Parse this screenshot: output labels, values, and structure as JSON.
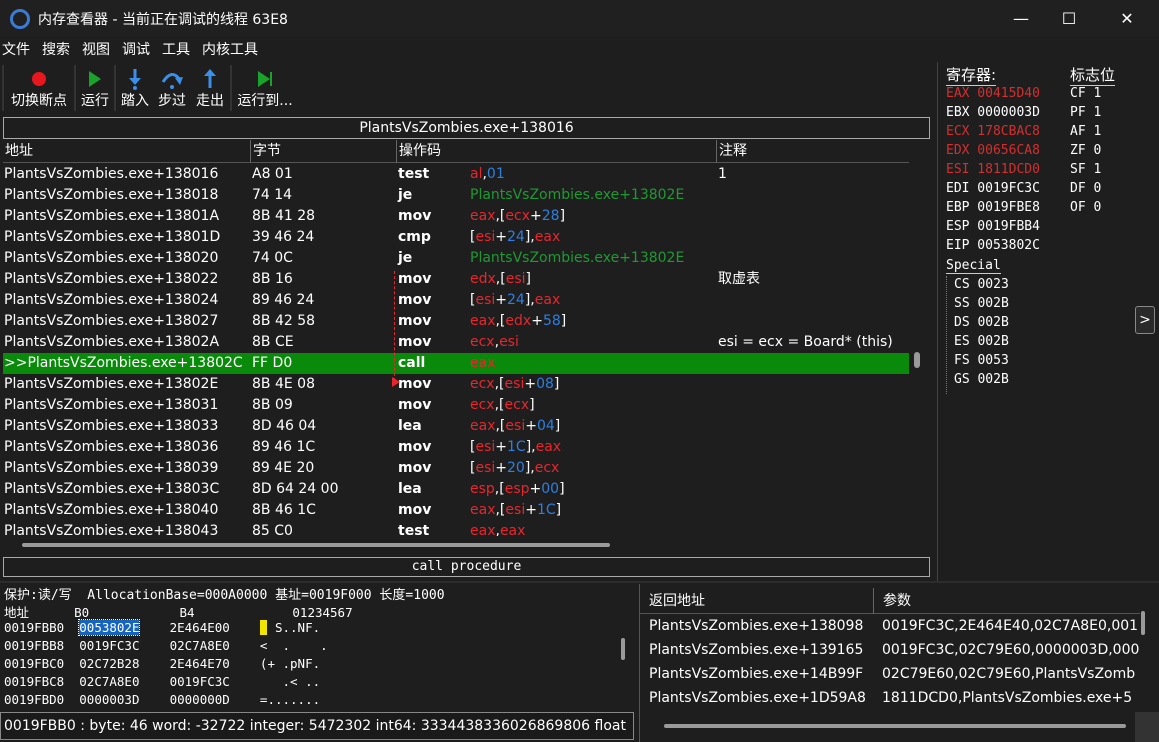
{
  "window": {
    "title": "内存查看器 - 当前正在调试的线程 63E8",
    "minimize": "—",
    "maximize": "☐",
    "close": "✕"
  },
  "menu": [
    "文件",
    "搜索",
    "视图",
    "调试",
    "工具",
    "内核工具"
  ],
  "toolbar": [
    {
      "label": "切换断点",
      "icon": "breakpoint-icon"
    },
    {
      "label": "运行",
      "icon": "play-icon"
    },
    {
      "label": "踏入",
      "icon": "step-into-icon"
    },
    {
      "label": "步过",
      "icon": "step-over-icon"
    },
    {
      "label": "走出",
      "icon": "step-out-icon"
    },
    {
      "label": "运行到...",
      "icon": "run-to-icon"
    }
  ],
  "disasm": {
    "header": "PlantsVsZombies.exe+138016",
    "columns": [
      "地址",
      "字节",
      "操作码",
      "注释"
    ],
    "rows": [
      {
        "addr": "PlantsVsZombies.exe+138016",
        "bytes": "A8 01",
        "op": "test",
        "args": [
          [
            "r",
            "al"
          ],
          [
            "w",
            ","
          ],
          [
            "b",
            "01"
          ]
        ],
        "cmt": "1"
      },
      {
        "addr": "PlantsVsZombies.exe+138018",
        "bytes": "74 14",
        "op": "je",
        "args": [
          [
            "g",
            "PlantsVsZombies.exe+13802E"
          ]
        ],
        "cmt": ""
      },
      {
        "addr": "PlantsVsZombies.exe+13801A",
        "bytes": "8B 41 28",
        "op": "mov",
        "args": [
          [
            "r",
            "eax"
          ],
          [
            "w",
            ",["
          ],
          [
            "r",
            "ecx"
          ],
          [
            "w",
            "+"
          ],
          [
            "b",
            "28"
          ],
          [
            "w",
            "]"
          ]
        ],
        "cmt": ""
      },
      {
        "addr": "PlantsVsZombies.exe+13801D",
        "bytes": "39 46 24",
        "op": "cmp",
        "args": [
          [
            "w",
            "["
          ],
          [
            "r",
            "esi"
          ],
          [
            "w",
            "+"
          ],
          [
            "b",
            "24"
          ],
          [
            "w",
            "],"
          ],
          [
            "r",
            "eax"
          ]
        ],
        "cmt": ""
      },
      {
        "addr": "PlantsVsZombies.exe+138020",
        "bytes": "74 0C",
        "op": "je",
        "args": [
          [
            "g",
            "PlantsVsZombies.exe+13802E"
          ]
        ],
        "cmt": ""
      },
      {
        "addr": "PlantsVsZombies.exe+138022",
        "bytes": "8B 16",
        "op": "mov",
        "args": [
          [
            "r",
            "edx"
          ],
          [
            "w",
            ",["
          ],
          [
            "r",
            "esi"
          ],
          [
            "w",
            "]"
          ]
        ],
        "cmt": "取虚表"
      },
      {
        "addr": "PlantsVsZombies.exe+138024",
        "bytes": "89 46 24",
        "op": "mov",
        "args": [
          [
            "w",
            "["
          ],
          [
            "r",
            "esi"
          ],
          [
            "w",
            "+"
          ],
          [
            "b",
            "24"
          ],
          [
            "w",
            "],"
          ],
          [
            "r",
            "eax"
          ]
        ],
        "cmt": ""
      },
      {
        "addr": "PlantsVsZombies.exe+138027",
        "bytes": "8B 42 58",
        "op": "mov",
        "args": [
          [
            "r",
            "eax"
          ],
          [
            "w",
            ",["
          ],
          [
            "r",
            "edx"
          ],
          [
            "w",
            "+"
          ],
          [
            "b",
            "58"
          ],
          [
            "w",
            "]"
          ]
        ],
        "cmt": ""
      },
      {
        "addr": "PlantsVsZombies.exe+13802A",
        "bytes": "8B CE",
        "op": "mov",
        "args": [
          [
            "r",
            "ecx"
          ],
          [
            "w",
            ","
          ],
          [
            "r",
            "esi"
          ]
        ],
        "cmt": "esi = ecx = Board* (this)"
      },
      {
        "addr": ">>PlantsVsZombies.exe+13802C",
        "bytes": "FF D0",
        "op": "call",
        "args": [
          [
            "r",
            "eax"
          ]
        ],
        "cmt": "",
        "selected": true
      },
      {
        "addr": "PlantsVsZombies.exe+13802E",
        "bytes": "8B 4E 08",
        "op": "mov",
        "args": [
          [
            "r",
            "ecx"
          ],
          [
            "w",
            ",["
          ],
          [
            "r",
            "esi"
          ],
          [
            "w",
            "+"
          ],
          [
            "b",
            "08"
          ],
          [
            "w",
            "]"
          ]
        ],
        "cmt": ""
      },
      {
        "addr": "PlantsVsZombies.exe+138031",
        "bytes": "8B 09",
        "op": "mov",
        "args": [
          [
            "r",
            "ecx"
          ],
          [
            "w",
            ",["
          ],
          [
            "r",
            "ecx"
          ],
          [
            "w",
            "]"
          ]
        ],
        "cmt": ""
      },
      {
        "addr": "PlantsVsZombies.exe+138033",
        "bytes": "8D 46 04",
        "op": "lea",
        "args": [
          [
            "r",
            "eax"
          ],
          [
            "w",
            ",["
          ],
          [
            "r",
            "esi"
          ],
          [
            "w",
            "+"
          ],
          [
            "b",
            "04"
          ],
          [
            "w",
            "]"
          ]
        ],
        "cmt": ""
      },
      {
        "addr": "PlantsVsZombies.exe+138036",
        "bytes": "89 46 1C",
        "op": "mov",
        "args": [
          [
            "w",
            "["
          ],
          [
            "r",
            "esi"
          ],
          [
            "w",
            "+"
          ],
          [
            "b",
            "1C"
          ],
          [
            "w",
            "],"
          ],
          [
            "r",
            "eax"
          ]
        ],
        "cmt": ""
      },
      {
        "addr": "PlantsVsZombies.exe+138039",
        "bytes": "89 4E 20",
        "op": "mov",
        "args": [
          [
            "w",
            "["
          ],
          [
            "r",
            "esi"
          ],
          [
            "w",
            "+"
          ],
          [
            "b",
            "20"
          ],
          [
            "w",
            "],"
          ],
          [
            "r",
            "ecx"
          ]
        ],
        "cmt": ""
      },
      {
        "addr": "PlantsVsZombies.exe+13803C",
        "bytes": "8D 64 24 00",
        "op": "lea",
        "args": [
          [
            "r",
            "esp"
          ],
          [
            "w",
            ",["
          ],
          [
            "r",
            "esp"
          ],
          [
            "w",
            "+"
          ],
          [
            "b",
            "00"
          ],
          [
            "w",
            "]"
          ]
        ],
        "cmt": ""
      },
      {
        "addr": "PlantsVsZombies.exe+138040",
        "bytes": "8B 46 1C",
        "op": "mov",
        "args": [
          [
            "r",
            "eax"
          ],
          [
            "w",
            ",["
          ],
          [
            "r",
            "esi"
          ],
          [
            "w",
            "+"
          ],
          [
            "b",
            "1C"
          ],
          [
            "w",
            "]"
          ]
        ],
        "cmt": ""
      },
      {
        "addr": "PlantsVsZombies.exe+138043",
        "bytes": "85 C0",
        "op": "test",
        "args": [
          [
            "r",
            "eax"
          ],
          [
            "w",
            ","
          ],
          [
            "r",
            "eax"
          ]
        ],
        "cmt": ""
      }
    ],
    "status": "call procedure"
  },
  "registers": {
    "title": "寄存器:",
    "flags_title": "标志位",
    "special_title": "Special",
    "regs": [
      {
        "text": "EAX 00415D40",
        "changed": true
      },
      {
        "text": "EBX 0000003D",
        "changed": false
      },
      {
        "text": "ECX 178CBAC8",
        "changed": true
      },
      {
        "text": "EDX 00656CA8",
        "changed": true
      },
      {
        "text": "ESI 1811DCD0",
        "changed": true
      },
      {
        "text": "EDI 0019FC3C",
        "changed": false
      },
      {
        "text": "EBP 0019FBE8",
        "changed": false
      },
      {
        "text": "ESP 0019FBB4",
        "changed": false
      },
      {
        "text": "EIP 0053802C",
        "changed": false
      }
    ],
    "flags": [
      "CF 1",
      "PF 1",
      "AF 1",
      "ZF 0",
      "SF 1",
      "DF 0",
      "OF 0"
    ],
    "segments": [
      "CS 0023",
      "SS 002B",
      "DS 002B",
      "ES 002B",
      "FS 0053",
      "GS 002B"
    ],
    "expand": ">",
    "color_changed": "#d32f2f"
  },
  "hexview": {
    "info": "保护:读/写  AllocationBase=000A0000 基址=0019F000 长度=1000",
    "header": "地址      B0            B4             01234567",
    "rows": [
      {
        "addr": "0019FBB0",
        "c1": "0053802E",
        "c2": "2E464E00",
        "ascii": "  S..NF.",
        "hl": true
      },
      {
        "addr": "0019FBB8",
        "c1": "0019FC3C",
        "c2": "02C7A8E0",
        "ascii": "<  .    ."
      },
      {
        "addr": "0019FBC0",
        "c1": "02C72B28",
        "c2": "2E464E70",
        "ascii": "(+ .pNF."
      },
      {
        "addr": "0019FBC8",
        "c1": "02C7A8E0",
        "c2": "0019FC3C",
        "ascii": "   .< .."
      },
      {
        "addr": "0019FBD0",
        "c1": "0000003D",
        "c2": "0000000D",
        "ascii": "=......."
      }
    ],
    "status": "0019FBB0 : byte: 46 word: -32722 integer: 5472302 int64: 3334438336026869806 float"
  },
  "stack": {
    "columns": [
      "返回地址",
      "参数"
    ],
    "rows": [
      {
        "ret": "PlantsVsZombies.exe+138098",
        "args": "0019FC3C,2E464E40,02C7A8E0,001"
      },
      {
        "ret": "PlantsVsZombies.exe+139165",
        "args": "0019FC3C,02C79E60,0000003D,000"
      },
      {
        "ret": "PlantsVsZombies.exe+14B99F",
        "args": "02C79E60,02C79E60,PlantsVsZomb"
      },
      {
        "ret": "PlantsVsZombies.exe+1D59A8",
        "args": "1811DCD0,PlantsVsZombies.exe+5"
      }
    ]
  }
}
